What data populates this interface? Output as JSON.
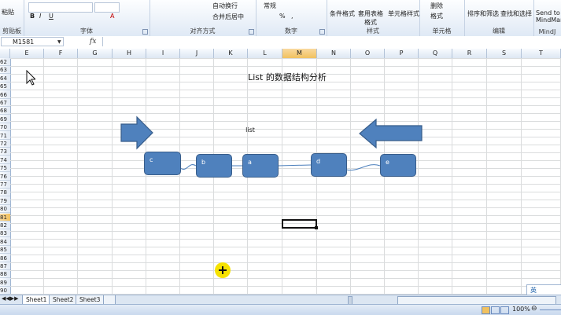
{
  "ribbon": {
    "groups": [
      {
        "label": "剪贴板",
        "items": [
          "粘贴"
        ]
      },
      {
        "label": "字体",
        "items": [
          "B",
          "I",
          "U",
          "A"
        ]
      },
      {
        "label": "对齐方式",
        "items": [
          "自动换行",
          "合并后居中"
        ]
      },
      {
        "label": "数字",
        "items": [
          "常规",
          "%",
          ","
        ]
      },
      {
        "label": "样式",
        "items": [
          "条件格式",
          "套用表格格式",
          "单元格样式"
        ]
      },
      {
        "label": "单元格",
        "items": [
          "删除",
          "格式"
        ]
      },
      {
        "label": "编辑",
        "items": [
          "排序和筛选",
          "查找和选择"
        ]
      },
      {
        "label": "MindJ",
        "items": [
          "Send to MindMan"
        ]
      }
    ]
  },
  "formula_bar": {
    "name_box": "M1581",
    "fx": "fx",
    "value": ""
  },
  "columns": [
    "E",
    "F",
    "G",
    "H",
    "I",
    "J",
    "K",
    "L",
    "M",
    "N",
    "O",
    "P",
    "Q",
    "R",
    "S",
    "T"
  ],
  "selected_column": "M",
  "rows": [
    "62",
    "63",
    "64",
    "65",
    "66",
    "67",
    "68",
    "69",
    "70",
    "71",
    "72",
    "73",
    "74",
    "75",
    "76",
    "77",
    "78",
    "79",
    "80",
    "81",
    "82",
    "83",
    "84",
    "85",
    "86",
    "87",
    "88",
    "89",
    "90"
  ],
  "selected_row": "81",
  "sheet": {
    "title": "List 的数据结构分析",
    "list_label": "list",
    "nodes": [
      "c",
      "b",
      "a",
      "d",
      "e"
    ]
  },
  "tabs": [
    "Sheet1",
    "Sheet2",
    "Sheet3"
  ],
  "active_tab": "Sheet1",
  "status": {
    "zoom": "100%"
  },
  "ime": {
    "label": "英"
  },
  "colors": {
    "node_fill": "#4f81bd",
    "node_border": "#385d8a",
    "selection": "#f1c15f",
    "cursor": "#f6e200"
  }
}
